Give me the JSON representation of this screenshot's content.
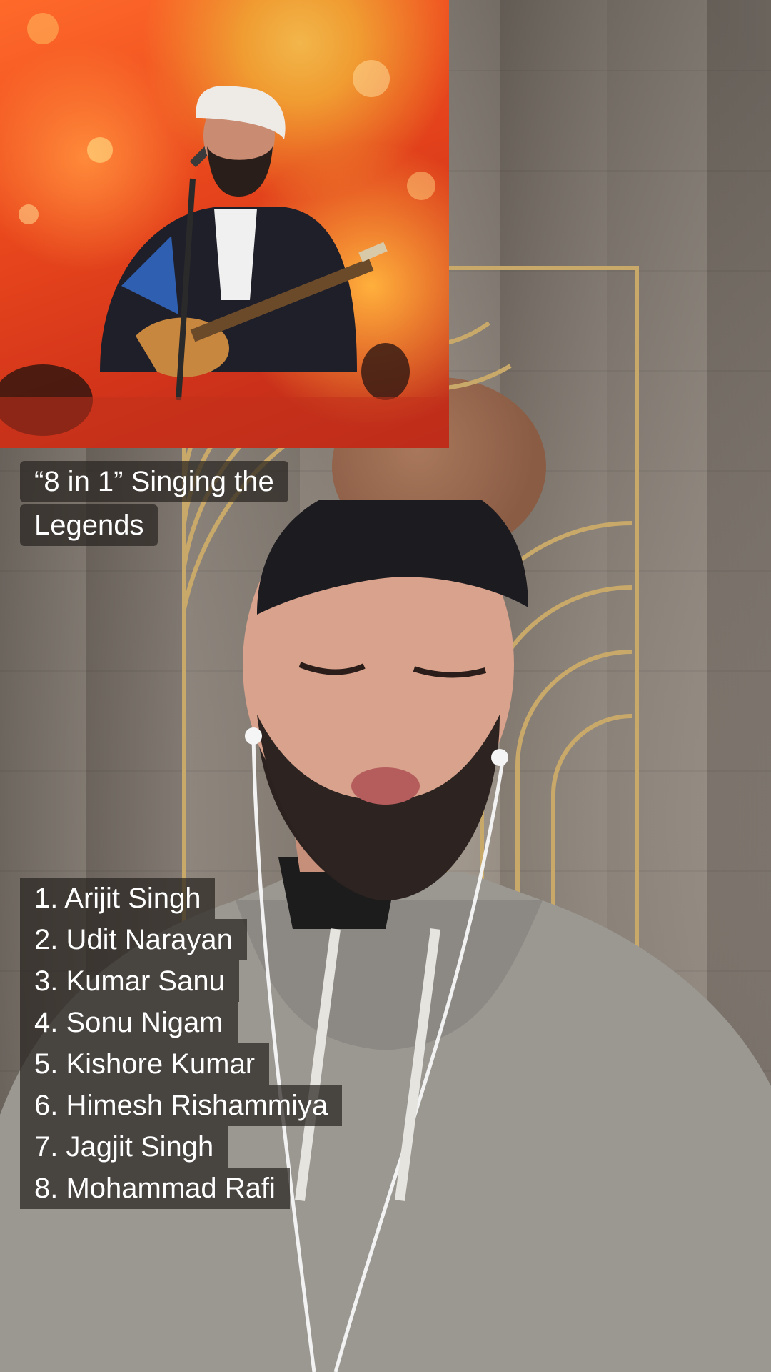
{
  "overlay": {
    "title_lines": [
      "“8 in 1” Singing the",
      "Legends"
    ],
    "singers": [
      "1. Arijit Singh",
      "2. Udit Narayan",
      "3. Kumar Sanu",
      "4. Sonu Nigam",
      "5. Kishore Kumar",
      "6. Himesh Rishammiya",
      "7. Jagjit Singh",
      "8. Mohammad Rafi"
    ]
  },
  "colors": {
    "caption_background": "#2a2520",
    "caption_text": "#ffffff",
    "inset_background": "#e8461c"
  }
}
